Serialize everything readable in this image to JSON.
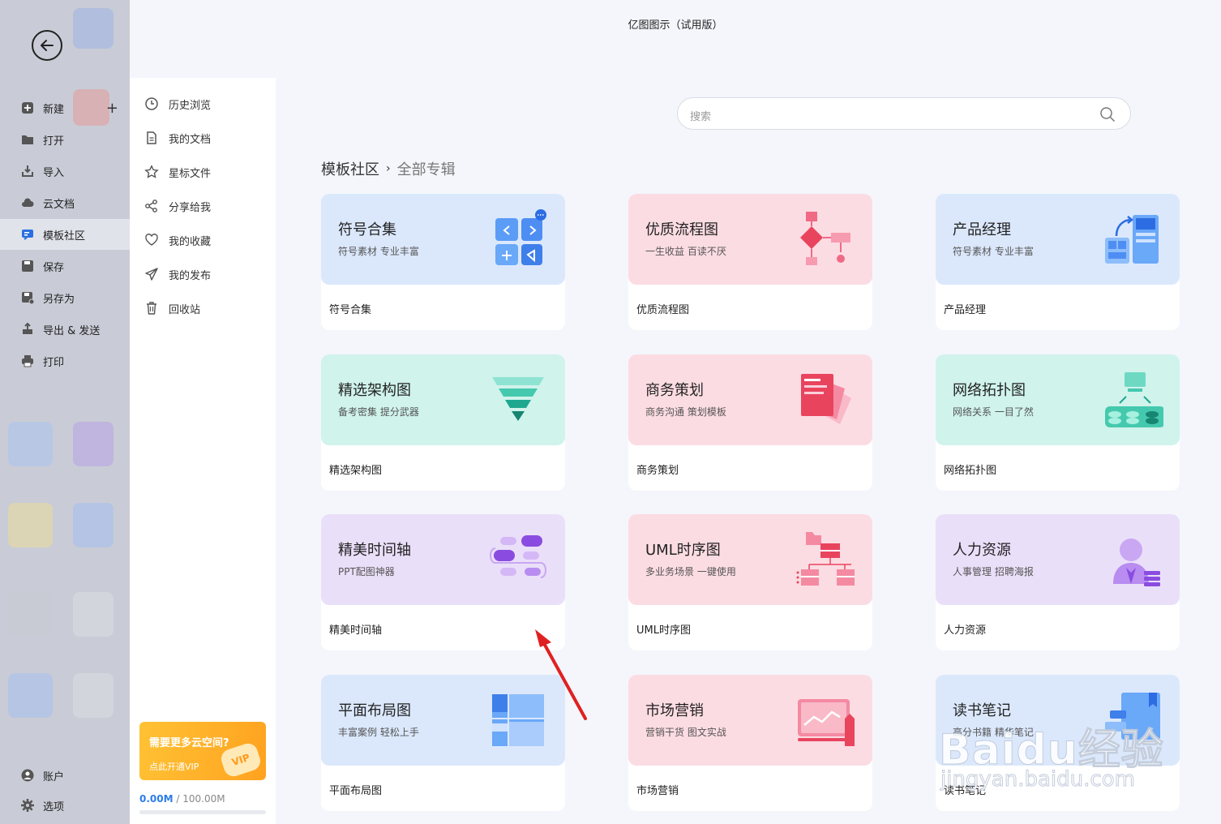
{
  "app": {
    "title": "亿图图示（试用版）"
  },
  "leftbar": {
    "items": [
      {
        "label": "新建",
        "icon": "plus-square-icon"
      },
      {
        "label": "打开",
        "icon": "folder-icon"
      },
      {
        "label": "导入",
        "icon": "import-icon"
      },
      {
        "label": "云文档",
        "icon": "cloud-icon"
      },
      {
        "label": "模板社区",
        "icon": "template-community-icon",
        "active": true
      },
      {
        "label": "保存",
        "icon": "save-icon"
      },
      {
        "label": "另存为",
        "icon": "save-as-icon"
      },
      {
        "label": "导出 & 发送",
        "icon": "export-icon"
      },
      {
        "label": "打印",
        "icon": "printer-icon"
      }
    ],
    "bottom": [
      {
        "label": "账户",
        "icon": "account-icon"
      },
      {
        "label": "选项",
        "icon": "gear-icon"
      }
    ]
  },
  "submenu": {
    "items": [
      {
        "label": "历史浏览",
        "icon": "clock-icon"
      },
      {
        "label": "我的文档",
        "icon": "document-icon"
      },
      {
        "label": "星标文件",
        "icon": "star-icon"
      },
      {
        "label": "分享给我",
        "icon": "share-icon"
      },
      {
        "label": "我的收藏",
        "icon": "heart-icon"
      },
      {
        "label": "我的发布",
        "icon": "send-icon"
      },
      {
        "label": "回收站",
        "icon": "trash-icon"
      }
    ],
    "vip": {
      "title": "需要更多云空间?",
      "cta": "点此开通VIP",
      "badge": "VIP"
    },
    "storage": {
      "used": "0.00M",
      "total": " / 100.00M",
      "fraction": 0
    }
  },
  "search": {
    "placeholder": "搜索"
  },
  "breadcrumb": {
    "root": "模板社区",
    "separator": "›",
    "current": "全部专辑"
  },
  "cards": [
    {
      "title": "符号合集",
      "subtitle": "符号素材 专业丰富",
      "footer": "符号合集",
      "color": "blue"
    },
    {
      "title": "优质流程图",
      "subtitle": "一生收益 百读不厌",
      "footer": "优质流程图",
      "color": "pink"
    },
    {
      "title": "产品经理",
      "subtitle": "符号素材 专业丰富",
      "footer": "产品经理",
      "color": "blue"
    },
    {
      "title": "精选架构图",
      "subtitle": "备考密集 提分武器",
      "footer": "精选架构图",
      "color": "mint"
    },
    {
      "title": "商务策划",
      "subtitle": "商务沟通 策划模板",
      "footer": "商务策划",
      "color": "pink"
    },
    {
      "title": "网络拓扑图",
      "subtitle": "网络关系 一目了然",
      "footer": "网络拓扑图",
      "color": "mint"
    },
    {
      "title": "精美时间轴",
      "subtitle": "PPT配图神器",
      "footer": "精美时间轴",
      "color": "lav"
    },
    {
      "title": "UML时序图",
      "subtitle": "多业务场景 一键使用",
      "footer": "UML时序图",
      "color": "pink"
    },
    {
      "title": "人力资源",
      "subtitle": "人事管理 招聘海报",
      "footer": "人力资源",
      "color": "lav"
    },
    {
      "title": "平面布局图",
      "subtitle": "丰富案例 轻松上手",
      "footer": "平面布局图",
      "color": "blue"
    },
    {
      "title": "市场营销",
      "subtitle": "营销干货 图文实战",
      "footer": "市场营销",
      "color": "pink"
    },
    {
      "title": "读书笔记",
      "subtitle": "高分书籍 精华笔记",
      "footer": "读书笔记",
      "color": "blue"
    }
  ],
  "watermark": {
    "brand": "Baidu经验",
    "url": "jingyan.baidu.com"
  }
}
